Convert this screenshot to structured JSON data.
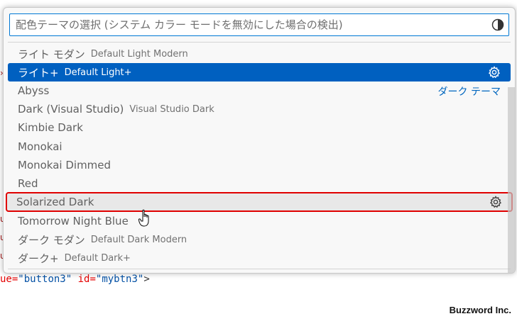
{
  "search": {
    "placeholder": "配色テーマの選択 (システム カラー モードを無効にした場合の検出)"
  },
  "icons": {
    "contrast": "contrast-icon",
    "gear": "gear-icon",
    "cursor": "hand-cursor-icon"
  },
  "colors": {
    "selection": "#0060c0",
    "focus_border": "#0078d4",
    "group_label": "#0066bf",
    "highlight_box": "#e00000"
  },
  "themes": [
    {
      "label": "ライト モダン",
      "description": "Default Light Modern",
      "state": "normal"
    },
    {
      "label": "ライト+",
      "description": "Default Light+",
      "state": "selected"
    },
    {
      "label": "Abyss",
      "description": "",
      "state": "normal",
      "group": "ダーク テーマ"
    },
    {
      "label": "Dark (Visual Studio)",
      "description": "Visual Studio Dark",
      "state": "normal"
    },
    {
      "label": "Kimbie Dark",
      "description": "",
      "state": "normal"
    },
    {
      "label": "Monokai",
      "description": "",
      "state": "normal"
    },
    {
      "label": "Monokai Dimmed",
      "description": "",
      "state": "normal"
    },
    {
      "label": "Red",
      "description": "",
      "state": "normal"
    },
    {
      "label": "Solarized Dark",
      "description": "",
      "state": "hovered"
    },
    {
      "label": "Tomorrow Night Blue",
      "description": "",
      "state": "normal"
    },
    {
      "label": "ダーク モダン",
      "description": "Default Dark Modern",
      "state": "normal"
    },
    {
      "label": "ダーク+",
      "description": "Default Dark+",
      "state": "normal"
    }
  ],
  "editor": {
    "code_attr1": "ue=",
    "code_str1": "\"button3\"",
    "code_attr2": "id=",
    "code_str2": "\"mybtn3\"",
    "code_end": ">"
  },
  "brand": "Buzzword Inc."
}
